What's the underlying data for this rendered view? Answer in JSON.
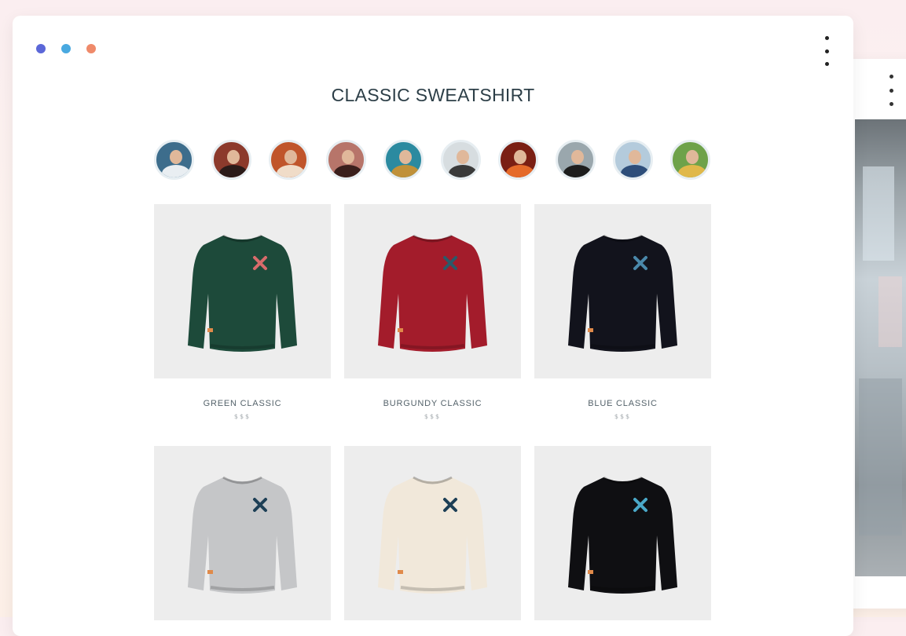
{
  "window": {
    "traffic_lights": [
      {
        "name": "blue",
        "color": "#5b67d8"
      },
      {
        "name": "cyan",
        "color": "#49a9e0"
      },
      {
        "name": "coral",
        "color": "#ef8a6a"
      }
    ],
    "menu_icon": "kebab-vertical-icon"
  },
  "page": {
    "title": "CLASSIC SWEATSHIRT"
  },
  "stories": [
    {
      "label": "story-1",
      "bg": "#3d6d8c",
      "body": "#e9eef2"
    },
    {
      "label": "story-2",
      "bg": "#8c3a2c",
      "body": "#2b1b19"
    },
    {
      "label": "story-3",
      "bg": "#c0552b",
      "body": "#f0dcc8"
    },
    {
      "label": "story-4",
      "bg": "#b7756a",
      "body": "#3a1f1c"
    },
    {
      "label": "story-5",
      "bg": "#2b8aa0",
      "body": "#c0913a"
    },
    {
      "label": "story-6",
      "bg": "#d7dde0",
      "body": "#3a3a3a"
    },
    {
      "label": "story-7",
      "bg": "#7a1f14",
      "body": "#e56a2a"
    },
    {
      "label": "story-8",
      "bg": "#9aa7ad",
      "body": "#1d1d1d"
    },
    {
      "label": "story-9",
      "bg": "#b4cbdc",
      "body": "#2e4e7a"
    },
    {
      "label": "story-10",
      "bg": "#6ea24a",
      "body": "#e0b84a"
    }
  ],
  "products": [
    {
      "name": "GREEN CLASSIC",
      "price": "$$$",
      "color": "#1d4a3a",
      "logo": "#d86b6b"
    },
    {
      "name": "BURGUNDY CLASSIC",
      "price": "$$$",
      "color": "#a31c2b",
      "logo": "#2a5a6a"
    },
    {
      "name": "BLUE CLASSIC",
      "price": "$$$",
      "color": "#12131c",
      "logo": "#4a88aa"
    },
    {
      "name": "",
      "price": "",
      "color": "#c5c6c8",
      "logo": "#1d3f56"
    },
    {
      "name": "",
      "price": "",
      "color": "#f1e8da",
      "logo": "#1d3f56"
    },
    {
      "name": "",
      "price": "",
      "color": "#0f0f12",
      "logo": "#4aa8c8"
    }
  ]
}
